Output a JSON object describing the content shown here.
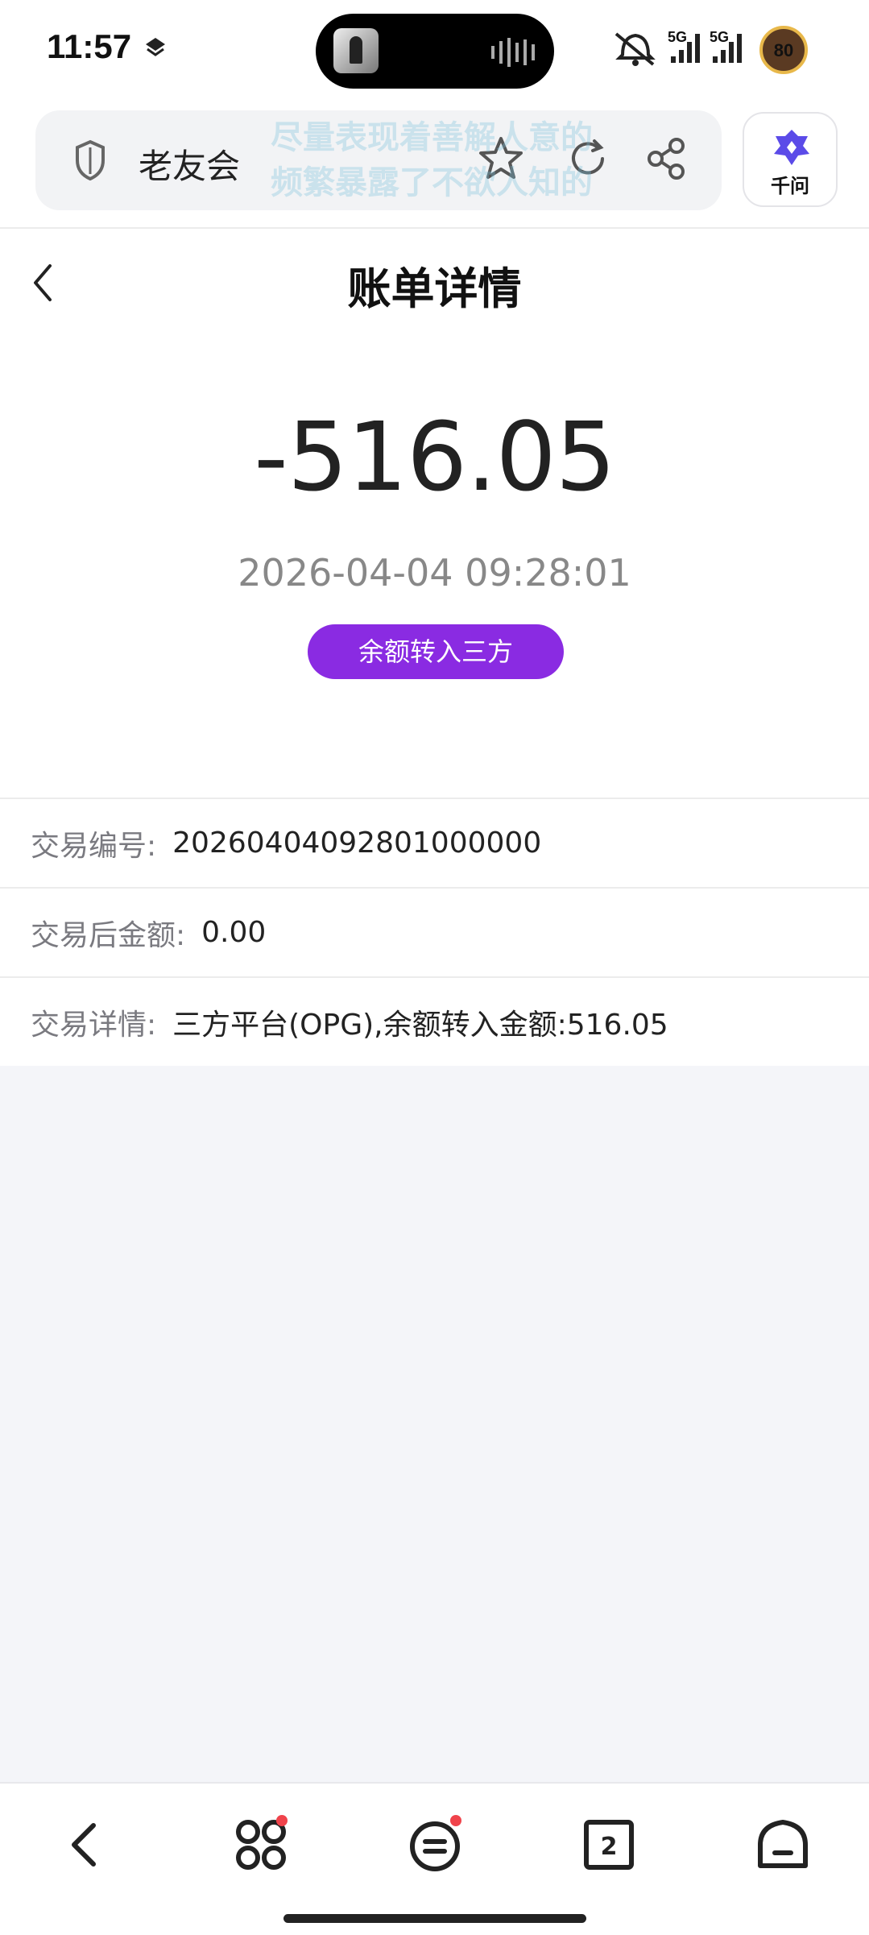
{
  "status_bar": {
    "time": "11:57",
    "network_1": "5G",
    "network_2": "5G",
    "battery": "80",
    "icons": [
      "location-layers-icon",
      "mute-bell-icon",
      "signal-icon",
      "battery-icon"
    ]
  },
  "browser": {
    "site_name": "老友会",
    "watermark_line1": "尽量表现着善解人意的",
    "watermark_line2": "频繁暴露了不欲人知的",
    "ai_label": "千问",
    "icons": [
      "shield-icon",
      "star-icon",
      "reload-icon",
      "share-icon",
      "qianwen-logo-icon"
    ]
  },
  "page": {
    "title": "账单详情",
    "amount": "-516.05",
    "datetime": "2026-04-04 09:28:01",
    "tag": "余额转入三方"
  },
  "details": [
    {
      "label": "交易编号:",
      "value": "20260404092801000000"
    },
    {
      "label": "交易后金额:",
      "value": "0.00"
    },
    {
      "label": "交易详情:",
      "value": "三方平台(OPG),余额转入金额:516.05"
    }
  ],
  "bottom_nav": {
    "page_count": "2",
    "icons": [
      "back-icon",
      "apps-icon",
      "menu-icon",
      "tabs-icon",
      "home-icon"
    ]
  },
  "colors": {
    "accent": "#8a2be2",
    "badge_dot": "#f0434b",
    "page_background": "#f4f5f9"
  }
}
